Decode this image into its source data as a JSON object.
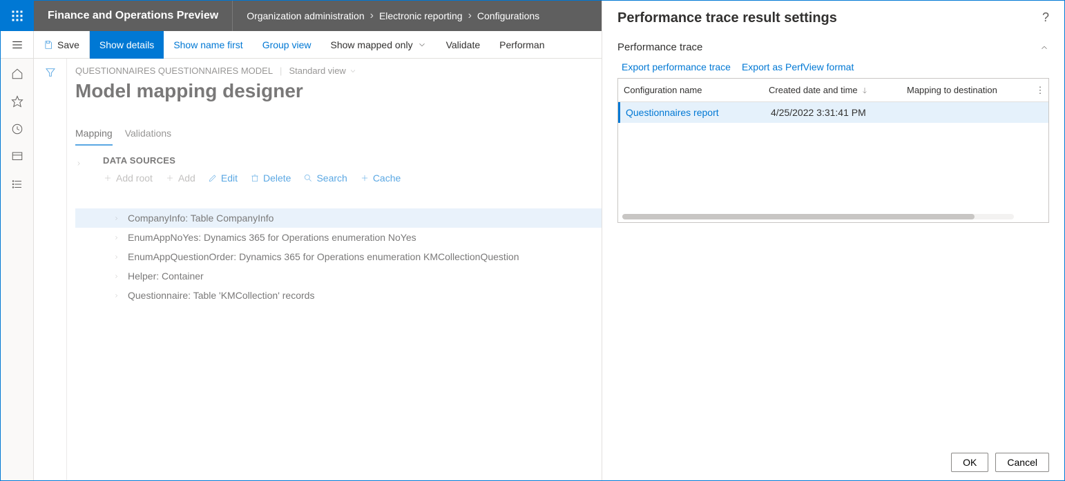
{
  "topbar": {
    "product": "Finance and Operations Preview",
    "breadcrumbs": [
      "Organization administration",
      "Electronic reporting",
      "Configurations"
    ]
  },
  "actionbar": {
    "save": "Save",
    "show_details": "Show details",
    "show_name_first": "Show name first",
    "group_view": "Group view",
    "show_mapped_only": "Show mapped only",
    "validate": "Validate",
    "performance": "Performan"
  },
  "page": {
    "meta": "QUESTIONNAIRES QUESTIONNAIRES MODEL",
    "view_label": "Standard view",
    "title": "Model mapping designer",
    "tabs": {
      "mapping": "Mapping",
      "validations": "Validations"
    }
  },
  "datasources": {
    "header": "DATA SOURCES",
    "actions": {
      "add_root": "Add root",
      "add": "Add",
      "edit": "Edit",
      "delete": "Delete",
      "search": "Search",
      "cache": "Cache"
    },
    "nodes": [
      "CompanyInfo: Table CompanyInfo",
      "EnumAppNoYes: Dynamics 365 for Operations enumeration NoYes",
      "EnumAppQuestionOrder: Dynamics 365 for Operations enumeration KMCollectionQuestion",
      "Helper: Container",
      "Questionnaire: Table 'KMCollection' records"
    ]
  },
  "panel": {
    "title": "Performance trace result settings",
    "section": "Performance trace",
    "export_trace": "Export performance trace",
    "export_perfview": "Export as PerfView format",
    "cols": {
      "config": "Configuration name",
      "created": "Created date and time",
      "mapping": "Mapping to destination"
    },
    "row": {
      "config": "Questionnaires report",
      "created": "4/25/2022 3:31:41 PM"
    },
    "ok": "OK",
    "cancel": "Cancel"
  }
}
